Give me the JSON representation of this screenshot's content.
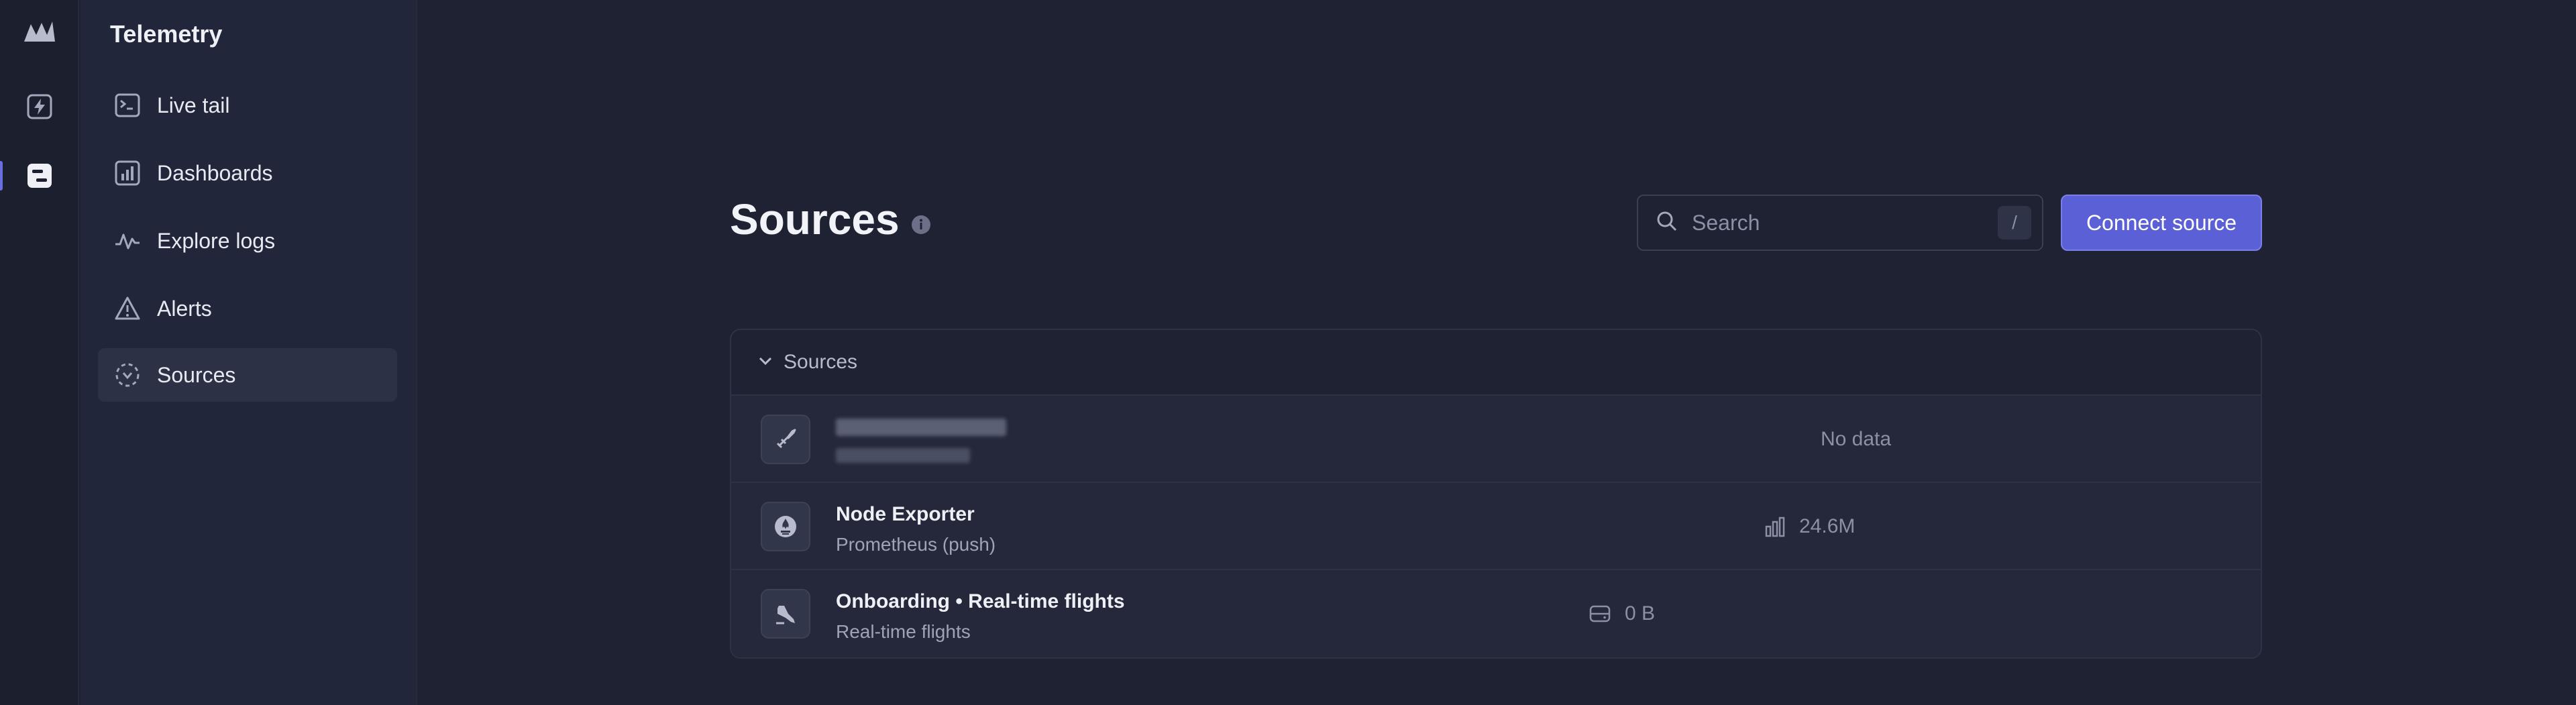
{
  "sidebar": {
    "title": "Telemetry",
    "items": [
      {
        "label": "Live tail",
        "icon": "terminal-icon"
      },
      {
        "label": "Dashboards",
        "icon": "bar-chart-icon"
      },
      {
        "label": "Explore logs",
        "icon": "pulse-icon"
      },
      {
        "label": "Alerts",
        "icon": "warning-icon"
      },
      {
        "label": "Sources",
        "icon": "sources-icon",
        "active": true
      }
    ]
  },
  "rail": {
    "icons": [
      "logo-icon",
      "bolt-icon",
      "telemetry-icon"
    ]
  },
  "header": {
    "title": "Sources",
    "search_placeholder": "Search",
    "search_shortcut": "/",
    "connect_label": "Connect source"
  },
  "colors": {
    "accent": "#5b60d6",
    "background": "#1f2233"
  },
  "panel": {
    "header_label": "Sources",
    "rows": [
      {
        "title": "",
        "subtitle": "",
        "blurred": true,
        "stat": "No data",
        "stat_icon": "",
        "icon": "rocket-icon"
      },
      {
        "title": "Node Exporter",
        "subtitle": "Prometheus (push)",
        "stat": "24.6M",
        "stat_icon": "bar-chart-icon",
        "icon": "prometheus-icon"
      },
      {
        "title": "Onboarding • Real-time flights",
        "subtitle": "Real-time flights",
        "stat": "0 B",
        "stat_icon": "storage-icon",
        "icon": "flight-icon"
      }
    ]
  }
}
